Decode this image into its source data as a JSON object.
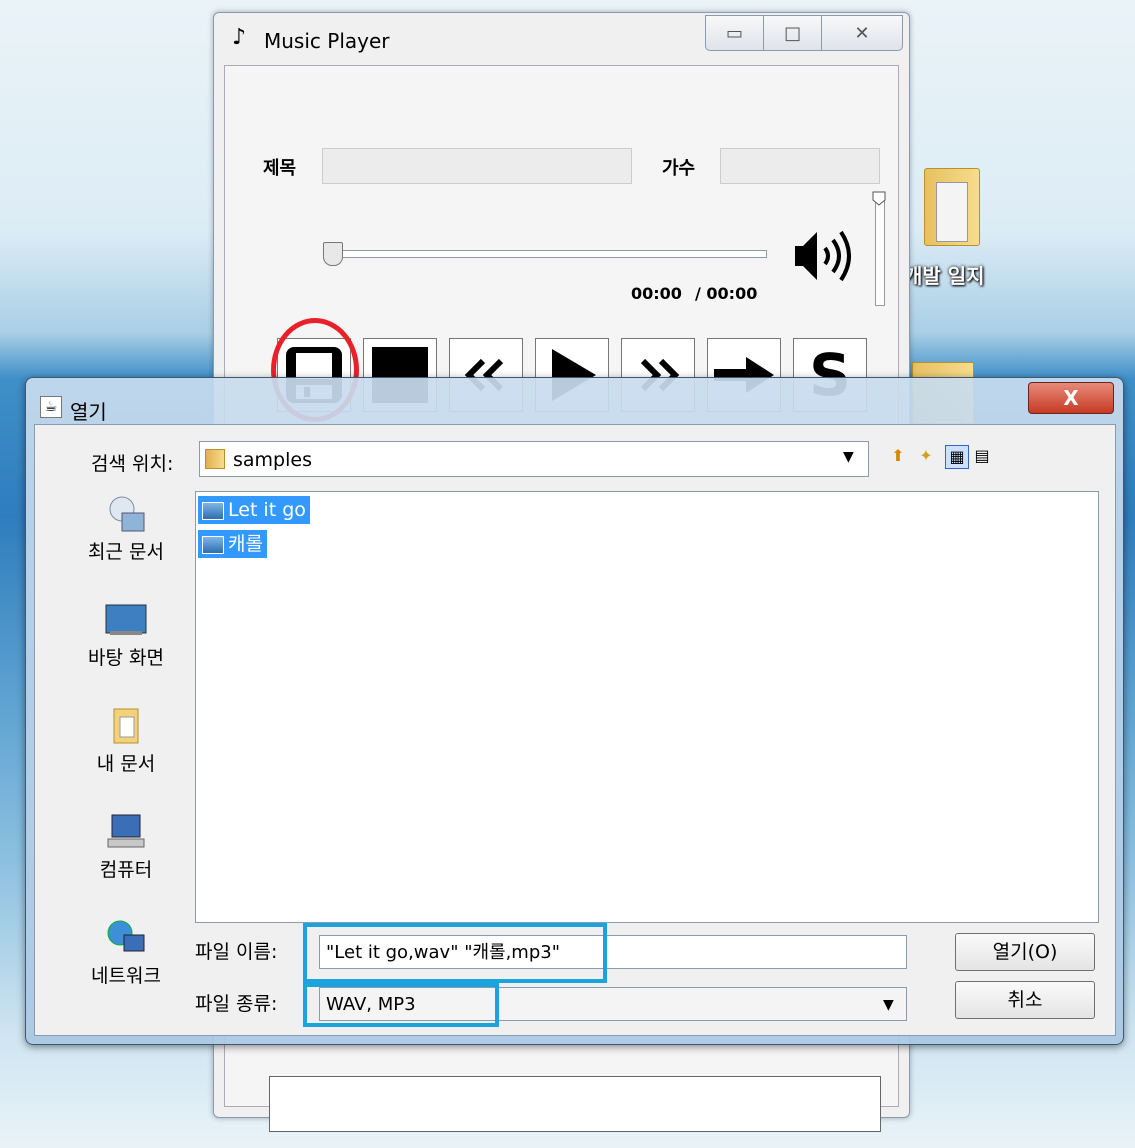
{
  "desktop": {
    "folder_label": "개발 일지"
  },
  "music_player": {
    "title": "Music Player",
    "title_icon": "♪",
    "window_controls": {
      "minimize": "▭",
      "maximize": "□",
      "close": "✕"
    },
    "labels": {
      "title": "제목",
      "artist": "가수"
    },
    "time": {
      "current": "00:00",
      "total": "/ 00:00"
    },
    "buttons": [
      {
        "name": "open-file-button",
        "icon": "save-floppy-icon"
      },
      {
        "name": "stop-button",
        "icon": "stop-icon"
      },
      {
        "name": "previous-button",
        "icon": "double-left-chevron-icon",
        "glyph": "‹‹"
      },
      {
        "name": "play-button",
        "icon": "play-icon"
      },
      {
        "name": "next-button",
        "icon": "double-right-chevron-icon",
        "glyph": "››"
      },
      {
        "name": "forward-button",
        "icon": "right-arrow-icon",
        "glyph": "➡"
      },
      {
        "name": "shuffle-button",
        "icon": "s-letter-icon",
        "glyph": "S"
      }
    ],
    "highlight_color": "#e8202a"
  },
  "open_dialog": {
    "title": "열기",
    "close_glyph": "X",
    "look_in_label": "검색 위치:",
    "look_in_value": "samples",
    "places": [
      {
        "label": "최근 문서",
        "icon": "recent-documents-icon"
      },
      {
        "label": "바탕 화면",
        "icon": "desktop-icon"
      },
      {
        "label": "내 문서",
        "icon": "my-documents-icon"
      },
      {
        "label": "컴퓨터",
        "icon": "computer-icon"
      },
      {
        "label": "네트워크",
        "icon": "network-icon"
      }
    ],
    "files": [
      {
        "name": "Let it go"
      },
      {
        "name": "캐롤"
      }
    ],
    "file_name_label": "파일 이름:",
    "file_name_value": "\"Let it go,wav\" \"캐롤,mp3\"",
    "file_type_label": "파일 종류:",
    "file_type_value": "WAV, MP3",
    "open_button": "열기(O)",
    "cancel_button": "취소",
    "highlight_color": "#1ba3dd"
  }
}
